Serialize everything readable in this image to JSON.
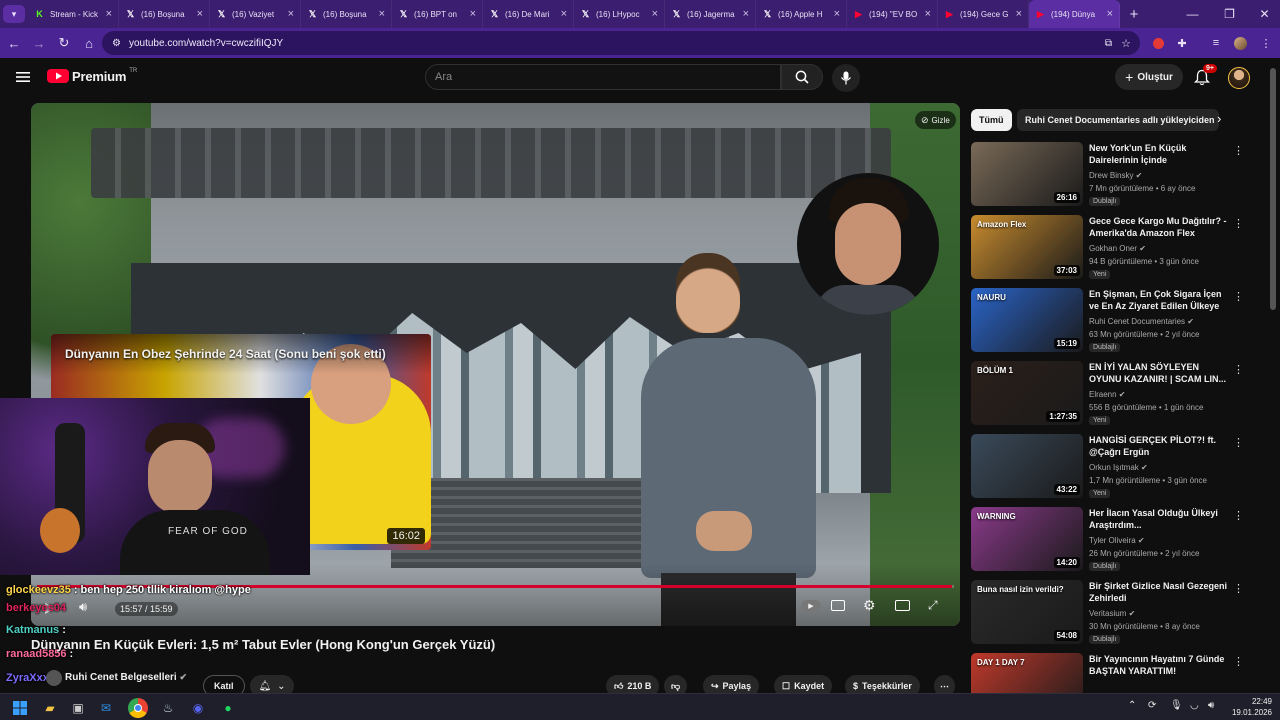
{
  "browser": {
    "tabs": [
      {
        "title": "Stream - Kick",
        "icon": "kick-icon",
        "color": "#53fc18",
        "glyph": "K"
      },
      {
        "title": "(16) Boşuna",
        "icon": "x-icon",
        "color": "#ffffff",
        "glyph": "𝕏"
      },
      {
        "title": "(16) Vaziyet",
        "icon": "x-icon",
        "color": "#ffffff",
        "glyph": "𝕏"
      },
      {
        "title": "(16) Boşuna",
        "icon": "x-icon",
        "color": "#ffffff",
        "glyph": "𝕏"
      },
      {
        "title": "(16) BPT on",
        "icon": "x-icon",
        "color": "#ffffff",
        "glyph": "𝕏"
      },
      {
        "title": "(16) De Mari",
        "icon": "x-icon",
        "color": "#ffffff",
        "glyph": "𝕏"
      },
      {
        "title": "(16) LHypoc",
        "icon": "x-icon",
        "color": "#ffffff",
        "glyph": "𝕏"
      },
      {
        "title": "(16) Jagerma",
        "icon": "x-icon",
        "color": "#ffffff",
        "glyph": "𝕏"
      },
      {
        "title": "(16) Apple H",
        "icon": "x-icon",
        "color": "#ffffff",
        "glyph": "𝕏"
      },
      {
        "title": "(194) \"EV BO",
        "icon": "youtube-icon",
        "color": "#ff0033",
        "glyph": "▶"
      },
      {
        "title": "(194) Gece G",
        "icon": "youtube-icon",
        "color": "#ff0033",
        "glyph": "▶"
      },
      {
        "title": "(194) Dünya",
        "icon": "youtube-icon",
        "color": "#ff0033",
        "glyph": "▶",
        "active": true
      }
    ],
    "url": "youtube.com/watch?v=cwczifiIQJY"
  },
  "youtube": {
    "logo_text": "Premium",
    "logo_sup": "TR",
    "search_placeholder": "Ara",
    "create_label": "Oluştur",
    "notif_count": "9+"
  },
  "player": {
    "hide_label": "Gizle",
    "time": "15:57 / 15:59",
    "progress": 0.998,
    "endcard": {
      "title": "Dünyanın En Obez Şehrinde 24 Saat (Sonu beni şok etti)",
      "duration": "16:02"
    }
  },
  "stream": {
    "shirt_text": "FEAR OF GOD",
    "chat": [
      {
        "user": "glockeevz35",
        "msg": ": ben hep 250 tllik kiralıom @hype",
        "color": "#ffd54a"
      },
      {
        "user": "berkeyes04",
        "msg": "",
        "color": "#e0245e"
      },
      {
        "user": "Katmanus",
        "msg": ":",
        "color": "#4fd1c5"
      },
      {
        "user": "ranaad5856",
        "msg": ":",
        "color": "#ff6b9d"
      },
      {
        "user": "ZyraXxx",
        "msg": ":",
        "color": "#7c6cff"
      }
    ]
  },
  "video": {
    "title": "Dünyanın En Küçük Evleri: 1,5 m² Tabut Evler (Hong Kong'un Gerçek Yüzü)",
    "channel": "Ruhi Cenet Belgeselleri",
    "join_label": "Katıl",
    "likes": "210 B",
    "share_label": "Paylaş",
    "save_label": "Kaydet",
    "thanks_label": "Teşekkürler"
  },
  "sidebar": {
    "chips": [
      "Tümü",
      "Ruhi Cenet Documentaries adlı yükleyiciden"
    ],
    "items": [
      {
        "title": "New York'un En Küçük Dairelerinin İçinde",
        "channel": "Drew Binsky",
        "meta": "7 Mn görüntüleme • 6 ay önce",
        "badge": "Dublajlı",
        "duration": "26:16",
        "thumb": "#7a6a58",
        "tag": ""
      },
      {
        "title": "Gece Gece Kargo Mu Dağıtılır? - Amerika'da Amazon Flex",
        "channel": "Gokhan Oner",
        "meta": "94 B görüntüleme • 3 gün önce",
        "badge": "Yeni",
        "duration": "37:03",
        "thumb": "#c98c2e",
        "tag": "Amazon Flex"
      },
      {
        "title": "En Şişman, En Çok Sigara İçen ve En Az Ziyaret Edilen Ülkeye ...",
        "channel": "Ruhi Cenet Documentaries",
        "meta": "63 Mn görüntüleme • 2 yıl önce",
        "badge": "Dublajlı",
        "duration": "15:19",
        "thumb": "#2a64c8",
        "tag": "NAURU"
      },
      {
        "title": "EN İYİ YALAN SÖYLEYEN OYUNU KAZANIR! | SCAM LIN...",
        "channel": "Elraenn",
        "meta": "556 B görüntüleme • 1 gün önce",
        "badge": "Yeni",
        "duration": "1:27:35",
        "thumb": "#2b1f1a",
        "tag": "BÖLÜM 1"
      },
      {
        "title": "HANGİSİ GERÇEK PİLOT?! ft. @Çağrı Ergün",
        "channel": "Orkun Işıtmak",
        "meta": "1,7 Mn görüntüleme • 3 gün önce",
        "badge": "Yeni",
        "duration": "43:22",
        "thumb": "#3a4a5a",
        "tag": ""
      },
      {
        "title": "Her İlacın Yasal Olduğu Ülkeyi Araştırdım...",
        "channel": "Tyler Oliveira",
        "meta": "26 Mn görüntüleme • 2 yıl önce",
        "badge": "Dublajlı",
        "duration": "14:20",
        "thumb": "#8a3a8a",
        "tag": "WARNING"
      },
      {
        "title": "Bir Şirket Gizlice Nasıl Gezegeni Zehirledi",
        "channel": "Veritasium",
        "meta": "30 Mn görüntüleme • 8 ay önce",
        "badge": "Dublajlı",
        "duration": "54:08",
        "thumb": "#2a2a2a",
        "tag": "Buna nasıl izin verildi?"
      },
      {
        "title": "Bir Yayıncının Hayatını 7 Günde BAŞTAN YARATTIM!",
        "channel": "",
        "meta": "",
        "badge": "",
        "duration": "",
        "thumb": "#c0392b",
        "tag": "DAY 1 DAY 7"
      }
    ]
  },
  "taskbar": {
    "time": "22:49",
    "date": "19.01.2026"
  }
}
